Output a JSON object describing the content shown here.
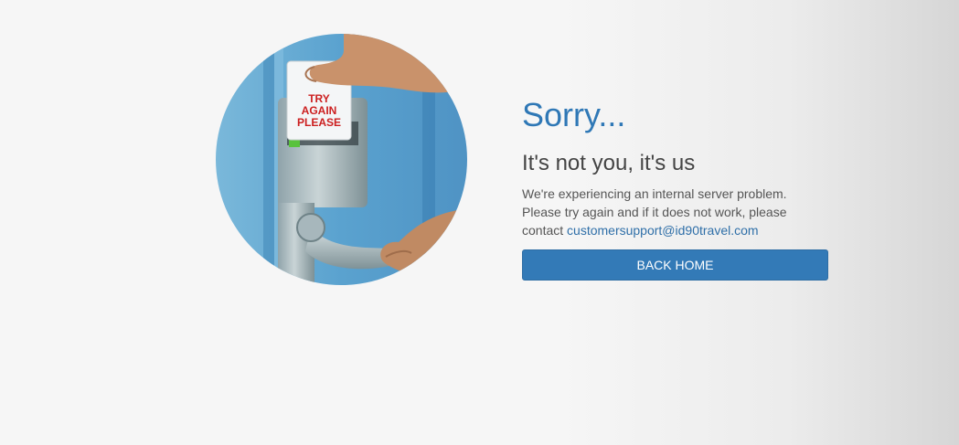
{
  "heading": "Sorry...",
  "subheading": "It's not you, it's us",
  "message": {
    "text": "We're experiencing an internal server problem. Please try again and if it does not work, please contact ",
    "email": "customersupport@id90travel.com"
  },
  "button": {
    "label": "BACK HOME"
  },
  "illustration": {
    "card_text": [
      "TRY",
      "AGAIN",
      "PLEASE"
    ]
  },
  "colors": {
    "accent": "#2f78b6",
    "button": "#337ab7",
    "card_text": "#cc1f1f"
  }
}
